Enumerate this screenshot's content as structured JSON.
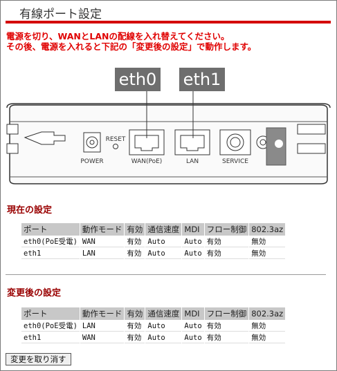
{
  "title": "有線ポート設定",
  "warning": {
    "line1": "電源を切り、WANとLANの配線を入れ替えてください。",
    "line2": "その後、電源を入れると下記の「変更後の設定」で動作します。"
  },
  "device": {
    "eth0_label": "eth0",
    "eth1_label": "eth1",
    "reset": "RESET",
    "power": "POWER",
    "wan": "WAN(PoE)",
    "lan": "LAN",
    "service": "SERVICE"
  },
  "headers": [
    "ポート",
    "動作モード",
    "有効",
    "通信速度",
    "MDI",
    "フロー制御",
    "802.3az"
  ],
  "current": {
    "title": "現在の設定",
    "rows": [
      [
        "eth0(PoE受電)",
        "WAN",
        "有効",
        "Auto",
        "Auto",
        "有効",
        "無効"
      ],
      [
        "eth1",
        "LAN",
        "有効",
        "Auto",
        "Auto",
        "有効",
        "無効"
      ]
    ]
  },
  "after": {
    "title": "変更後の設定",
    "rows": [
      [
        "eth0(PoE受電)",
        "LAN",
        "有効",
        "Auto",
        "Auto",
        "有効",
        "無効"
      ],
      [
        "eth1",
        "WAN",
        "有効",
        "Auto",
        "Auto",
        "有効",
        "無効"
      ]
    ]
  },
  "undo_button": "変更を取り消す"
}
